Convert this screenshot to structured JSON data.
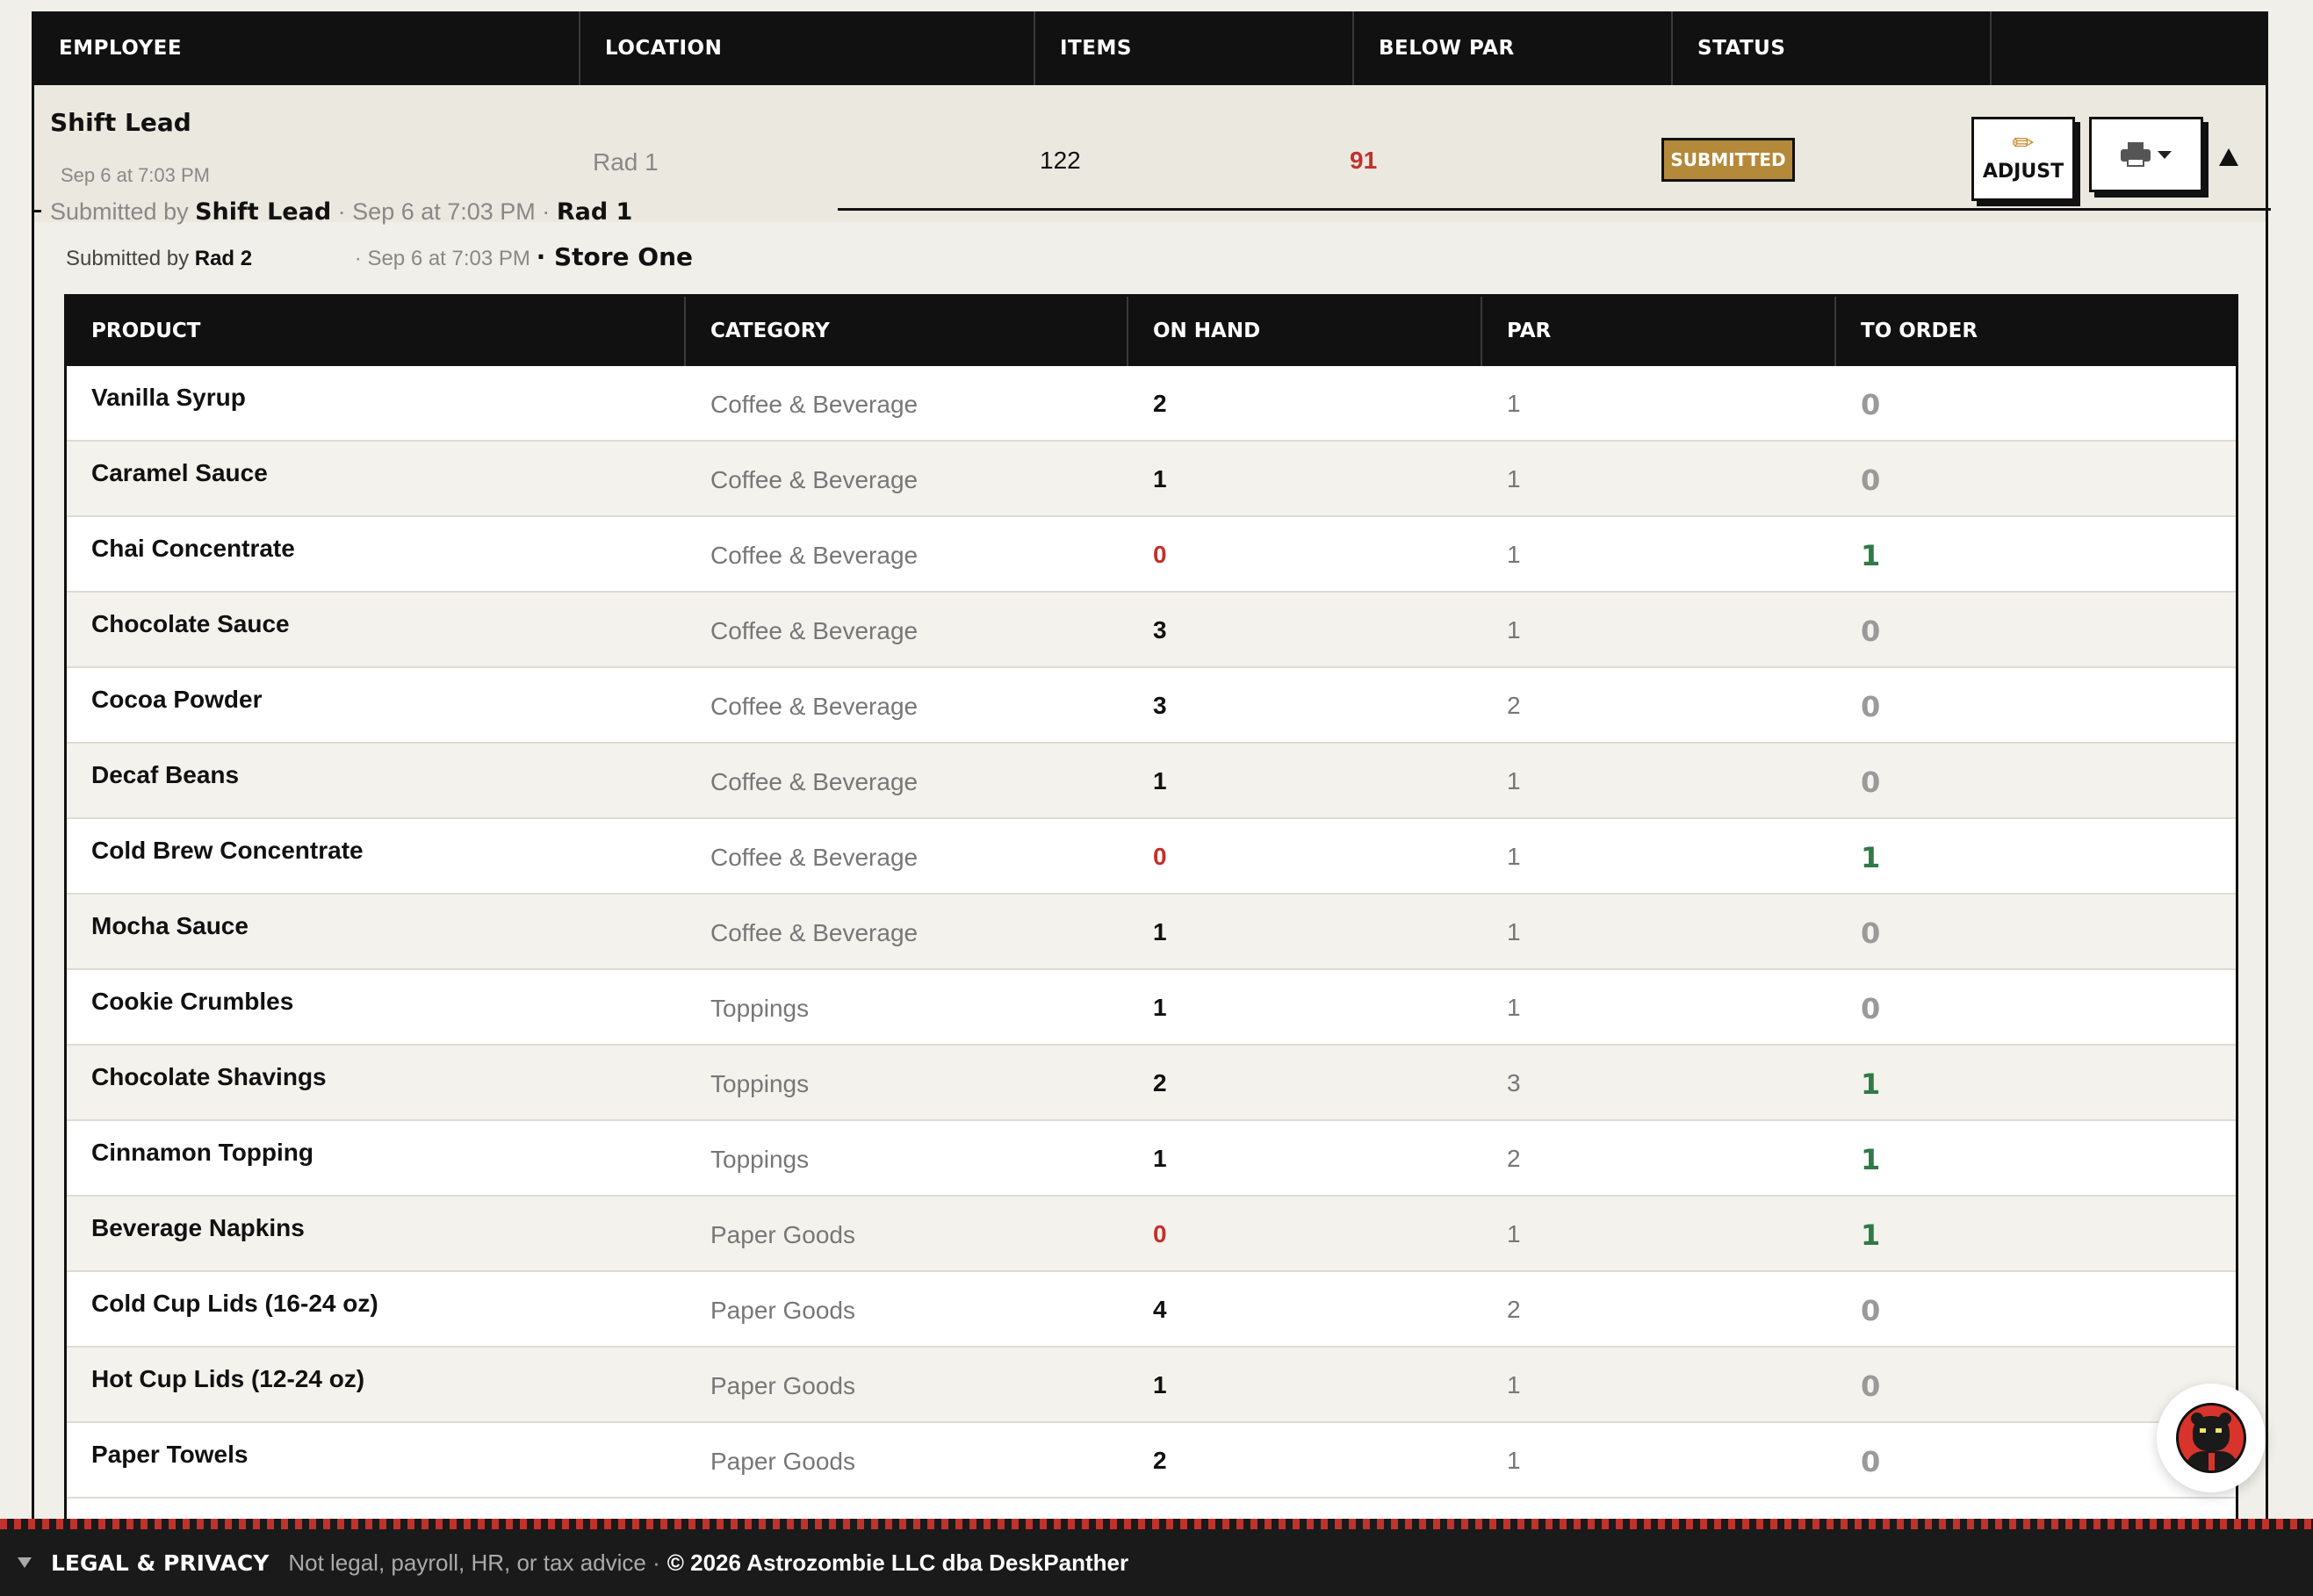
{
  "outer_table": {
    "headers": [
      "EMPLOYEE",
      "LOCATION",
      "ITEMS",
      "BELOW PAR",
      "STATUS",
      ""
    ]
  },
  "summary": {
    "employee": "Shift Lead",
    "time": "Sep 6 at 7:03 PM",
    "location": "Rad 1",
    "items": "122",
    "below_par": "91",
    "status": "SUBMITTED",
    "adjust_label": "ADJUST"
  },
  "submission_1": {
    "prefix": "Submitted by",
    "name": "Shift Lead",
    "time": "· Sep 6 at 7:03 PM ·",
    "location": "Rad 1"
  },
  "submission_2": {
    "prefix": "Submitted by",
    "name": "Rad 2",
    "time": "· Sep 6 at 7:03 PM",
    "store": "· Store One"
  },
  "inner_table": {
    "headers": [
      "PRODUCT",
      "CATEGORY",
      "ON HAND",
      "PAR",
      "TO ORDER"
    ],
    "rows": [
      {
        "product": "Vanilla Syrup",
        "category": "Coffee & Beverage",
        "on_hand": "2",
        "par": "1",
        "to_order": "0"
      },
      {
        "product": "Caramel Sauce",
        "category": "Coffee & Beverage",
        "on_hand": "1",
        "par": "1",
        "to_order": "0"
      },
      {
        "product": "Chai Concentrate",
        "category": "Coffee & Beverage",
        "on_hand": "0",
        "par": "1",
        "to_order": "1"
      },
      {
        "product": "Chocolate Sauce",
        "category": "Coffee & Beverage",
        "on_hand": "3",
        "par": "1",
        "to_order": "0"
      },
      {
        "product": "Cocoa Powder",
        "category": "Coffee & Beverage",
        "on_hand": "3",
        "par": "2",
        "to_order": "0"
      },
      {
        "product": "Decaf Beans",
        "category": "Coffee & Beverage",
        "on_hand": "1",
        "par": "1",
        "to_order": "0"
      },
      {
        "product": "Cold Brew Concentrate",
        "category": "Coffee & Beverage",
        "on_hand": "0",
        "par": "1",
        "to_order": "1"
      },
      {
        "product": "Mocha Sauce",
        "category": "Coffee & Beverage",
        "on_hand": "1",
        "par": "1",
        "to_order": "0"
      },
      {
        "product": "Cookie Crumbles",
        "category": "Toppings",
        "on_hand": "1",
        "par": "1",
        "to_order": "0"
      },
      {
        "product": "Chocolate Shavings",
        "category": "Toppings",
        "on_hand": "2",
        "par": "3",
        "to_order": "1"
      },
      {
        "product": "Cinnamon Topping",
        "category": "Toppings",
        "on_hand": "1",
        "par": "2",
        "to_order": "1"
      },
      {
        "product": "Beverage Napkins",
        "category": "Paper Goods",
        "on_hand": "0",
        "par": "1",
        "to_order": "1"
      },
      {
        "product": "Cold Cup Lids (16-24 oz)",
        "category": "Paper Goods",
        "on_hand": "4",
        "par": "2",
        "to_order": "0"
      },
      {
        "product": "Hot Cup Lids (12-24 oz)",
        "category": "Paper Goods",
        "on_hand": "1",
        "par": "1",
        "to_order": "0"
      },
      {
        "product": "Paper Towels",
        "category": "Paper Goods",
        "on_hand": "2",
        "par": "1",
        "to_order": "0"
      }
    ]
  },
  "footer": {
    "legal_label": "LEGAL & PRIVACY",
    "note": "Not legal, payroll, HR, or tax advice ·",
    "copyright": "© 2026 Astrozombie LLC dba DeskPanther"
  },
  "colors": {
    "accent_gold": "#b5893a",
    "alert_red": "#c0322b",
    "order_green": "#2f7a45"
  },
  "icons": {
    "adjust": "pencil-icon",
    "print": "printer-icon",
    "print_menu": "caret-down-icon",
    "collapse": "triangle-up-icon",
    "footer_toggle": "triangle-down-icon",
    "chat": "panther-avatar-icon"
  }
}
